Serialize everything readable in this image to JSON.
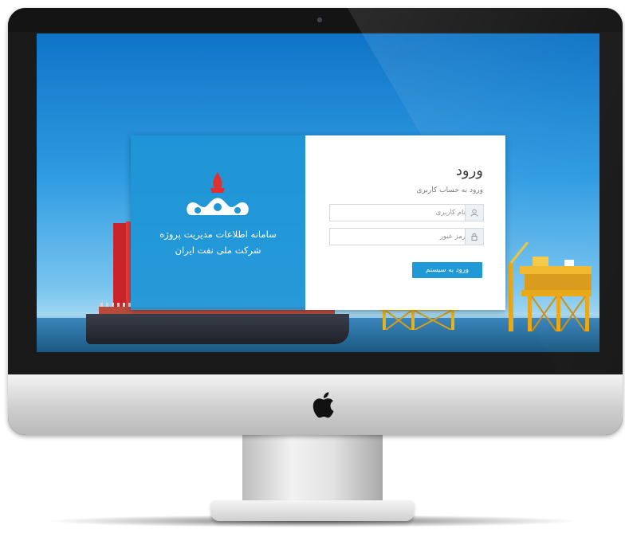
{
  "login": {
    "title": "ورود",
    "subtitle": "ورود به حساب کاربری",
    "username_placeholder": "نام کاربری",
    "password_placeholder": "رمز عبور",
    "submit_label": "ورود به سیستم"
  },
  "branding": {
    "line1": "سامانه اطلاعات مدیریت پروژه",
    "line2": "شرکت ملی نفت ایران"
  },
  "icons": {
    "username": "user-icon",
    "password": "lock-icon",
    "logo": "nioc-logo",
    "hardware": "apple-logo"
  },
  "colors": {
    "accent": "#1f9ad6",
    "brand_panel": "#1f96d6",
    "logo_flame": "#e03030"
  }
}
